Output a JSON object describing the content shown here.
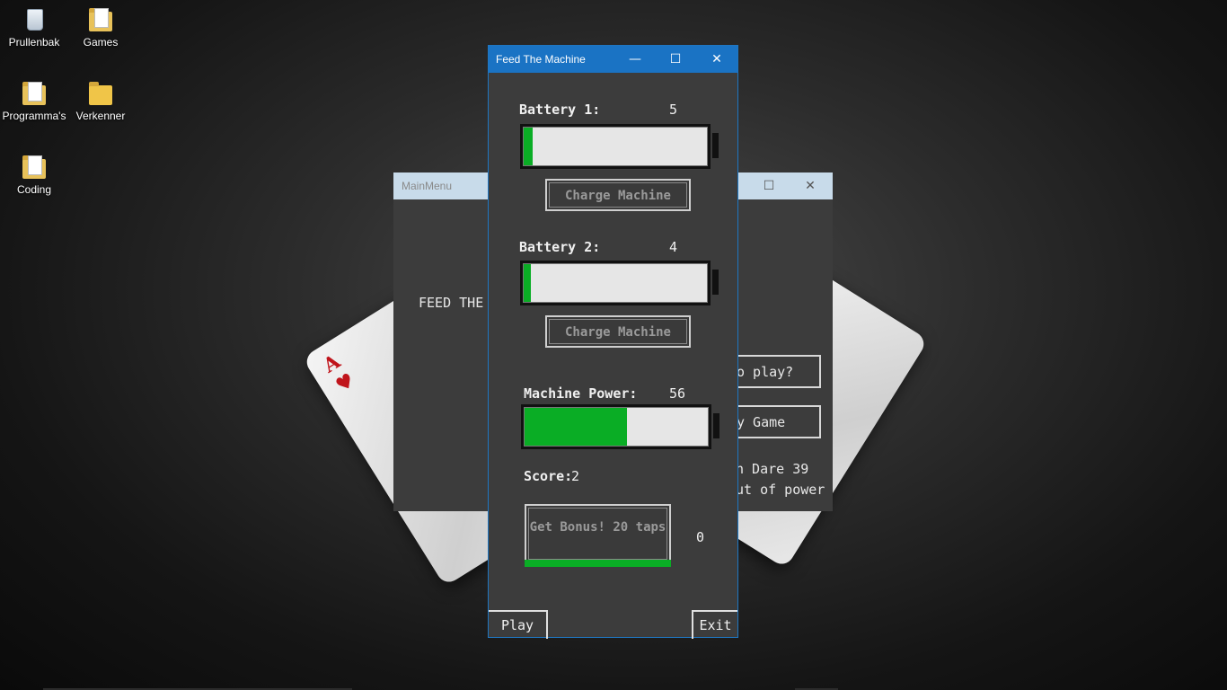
{
  "desktop": {
    "icons": [
      {
        "label": "Prullenbak",
        "icon": "recycle-bin-icon"
      },
      {
        "label": "Games",
        "icon": "folder-icon"
      },
      {
        "label": "Programma's",
        "icon": "folder-icon"
      },
      {
        "label": "Verkenner",
        "icon": "file-explorer-icon"
      },
      {
        "label": "Coding",
        "icon": "folder-icon"
      }
    ]
  },
  "main_menu": {
    "title": "MainMenu",
    "feed_text": "FEED THE M",
    "how_to_play": "o play?",
    "play_game": "y Game",
    "credit_line1": "n Dare 39",
    "credit_line2": "ut of power"
  },
  "game": {
    "title": "Feed The Machine",
    "battery1": {
      "label": "Battery 1:",
      "value": "5",
      "fill_percent": 5
    },
    "battery2": {
      "label": "Battery 2:",
      "value": "4",
      "fill_percent": 4
    },
    "charge_label": "Charge Machine",
    "machine": {
      "label": "Machine Power:",
      "value": "56",
      "fill_percent": 56
    },
    "score_label": "Score:",
    "score_value": "2",
    "bonus_label": "Get Bonus! 20 taps",
    "bonus_count": "0",
    "play_label": "Play",
    "exit_label": "Exit"
  },
  "colors": {
    "accent": "#1a73c4",
    "battery_fill": "#0aad25"
  }
}
